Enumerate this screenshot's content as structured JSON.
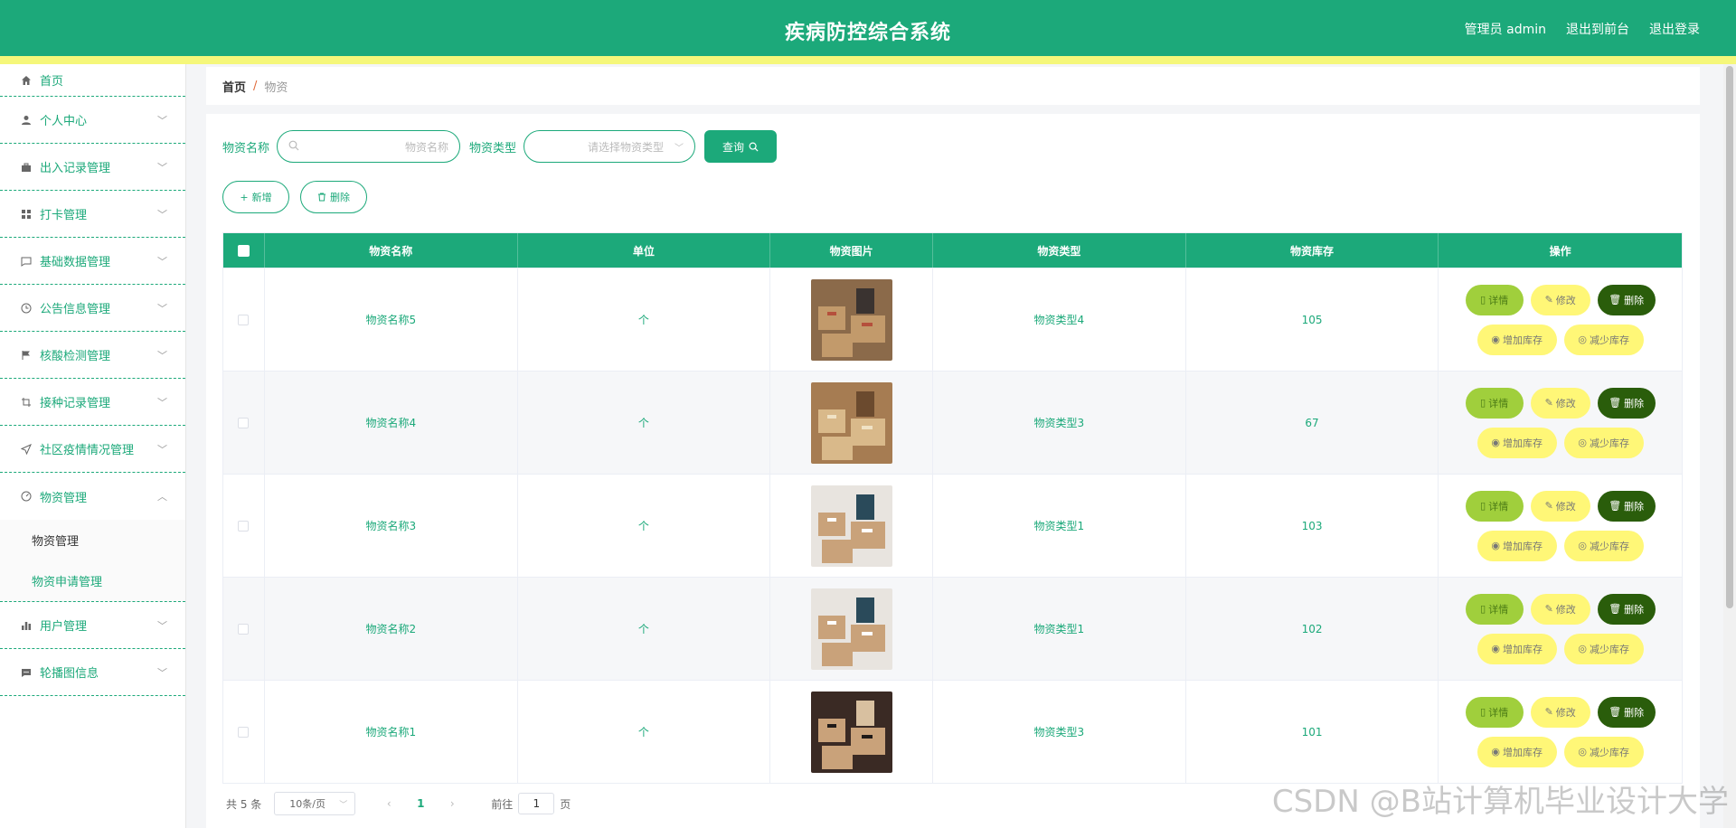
{
  "header": {
    "title": "疾病防控综合系统",
    "links": [
      "管理员 admin",
      "退出到前台",
      "退出登录"
    ]
  },
  "sidebar": {
    "items": [
      {
        "label": "首页",
        "icon": "home-icon"
      },
      {
        "label": "个人中心",
        "icon": "user-icon"
      },
      {
        "label": "出入记录管理",
        "icon": "briefcase-icon"
      },
      {
        "label": "打卡管理",
        "icon": "grid-icon"
      },
      {
        "label": "基础数据管理",
        "icon": "chat-icon"
      },
      {
        "label": "公告信息管理",
        "icon": "clock-icon"
      },
      {
        "label": "核酸检测管理",
        "icon": "flag-icon"
      },
      {
        "label": "接种记录管理",
        "icon": "crop-icon"
      },
      {
        "label": "社区疫情情况管理",
        "icon": "send-icon"
      },
      {
        "label": "物资管理",
        "icon": "gauge-icon"
      },
      {
        "label": "用户管理",
        "icon": "bar-chart-icon"
      },
      {
        "label": "轮播图信息",
        "icon": "message-icon"
      }
    ],
    "submenu": [
      "物资管理",
      "物资申请管理"
    ]
  },
  "breadcrumb": {
    "home": "首页",
    "sep": "/",
    "current": "物资"
  },
  "search": {
    "name_label": "物资名称",
    "name_placeholder": "物资名称",
    "type_label": "物资类型",
    "type_placeholder": "请选择物资类型",
    "query_button": "查询"
  },
  "actions": {
    "add": "新增",
    "delete": "删除"
  },
  "table": {
    "headers": [
      "物资名称",
      "单位",
      "物资图片",
      "物资类型",
      "物资库存",
      "操作"
    ],
    "rows": [
      {
        "name": "物资名称5",
        "unit": "个",
        "type": "物资类型4",
        "stock": "105"
      },
      {
        "name": "物资名称4",
        "unit": "个",
        "type": "物资类型3",
        "stock": "67"
      },
      {
        "name": "物资名称3",
        "unit": "个",
        "type": "物资类型1",
        "stock": "103"
      },
      {
        "name": "物资名称2",
        "unit": "个",
        "type": "物资类型1",
        "stock": "102"
      },
      {
        "name": "物资名称1",
        "unit": "个",
        "type": "物资类型3",
        "stock": "101"
      }
    ],
    "ops": {
      "detail": "详情",
      "edit": "修改",
      "delete": "删除",
      "increase": "增加库存",
      "decrease": "减少库存"
    }
  },
  "pagination": {
    "total": "共 5 条",
    "page_size": "10条/页",
    "current_page": "1",
    "goto_label": "前往",
    "goto_value": "1",
    "page_suffix": "页"
  },
  "watermark": "CSDN @B站计算机毕业设计大学",
  "colors": {
    "primary": "#1ca97a",
    "stripe": "#f5f77a",
    "detail": "#a0cf3c",
    "edit": "#fff777",
    "delete": "#2a5d0b"
  }
}
